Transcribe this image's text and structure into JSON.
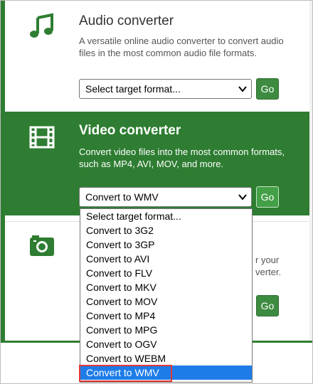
{
  "audio": {
    "title": "Audio converter",
    "description": "A versatile online audio converter to convert audio files in the most common audio file formats.",
    "select_value": "Select target format...",
    "go_label": "Go",
    "icon": "music-note-icon"
  },
  "video": {
    "title": "Video converter",
    "description": "Convert video files into the most common formats, such as MP4, AVI, MOV, and more.",
    "select_value": "Convert to WMV",
    "go_label": "Go",
    "icon": "film-icon"
  },
  "photo": {
    "partial_line1": "r your",
    "partial_line2": "verter.",
    "go_label": "Go",
    "icon": "camera-icon"
  },
  "dropdown": {
    "options": [
      "Select target format...",
      "Convert to 3G2",
      "Convert to 3GP",
      "Convert to AVI",
      "Convert to FLV",
      "Convert to MKV",
      "Convert to MOV",
      "Convert to MP4",
      "Convert to MPG",
      "Convert to OGV",
      "Convert to WEBM",
      "Convert to WMV"
    ],
    "selected_index": 11
  },
  "colors": {
    "brand_green": "#2e7d32",
    "selection_blue": "#1e7ce8",
    "highlight_red": "#e53935"
  }
}
